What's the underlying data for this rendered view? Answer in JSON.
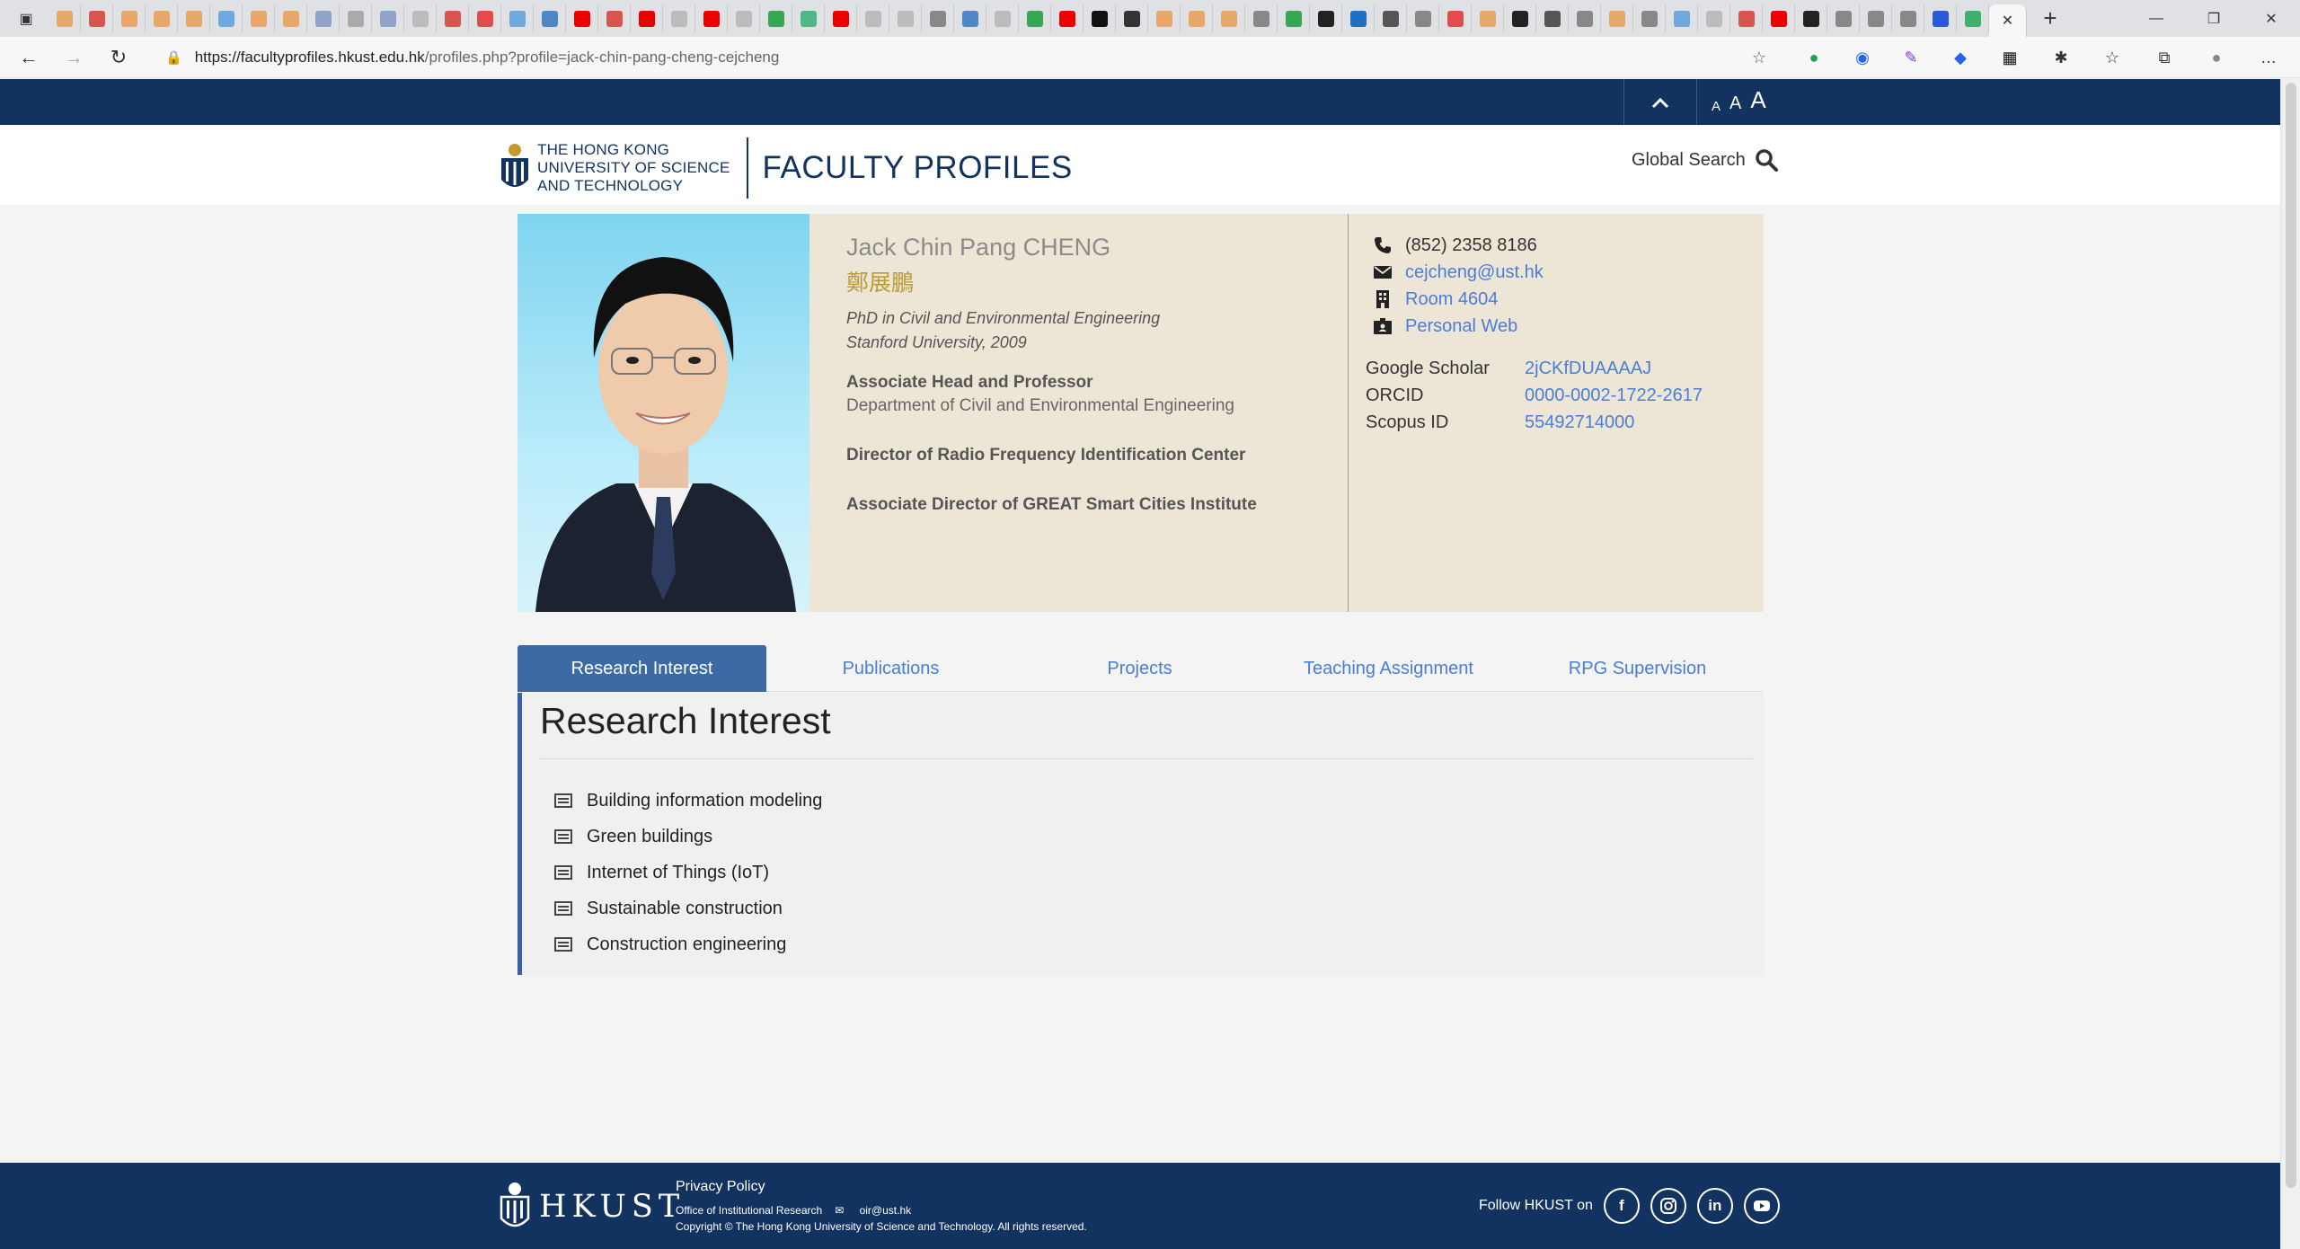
{
  "browser": {
    "url_domain": "https://facultyprofiles.hkust.edu.hk",
    "url_path": "/profiles.php?profile=jack-chin-pang-cheng-cejcheng",
    "tab_favicon_colors": [
      "#e8a86a",
      "#d9534f",
      "#e8a86a",
      "#e8a86a",
      "#e8a86a",
      "#6fa8dc",
      "#e8a86a",
      "#e8a86a",
      "#8fa4c8",
      "#aaa",
      "#8fa4c8",
      "#bbb",
      "#d9534f",
      "#e34c4c",
      "#6fa8dc",
      "#4f86c6",
      "#e00",
      "#d9534f",
      "#e00",
      "#bbb",
      "#e00",
      "#bbb",
      "#34a853",
      "#52b788",
      "#e00",
      "#bbb",
      "#bbb",
      "#888",
      "#4f86c6",
      "#bbb",
      "#34a853",
      "#e00",
      "#111",
      "#333",
      "#e8a86a",
      "#e8a86a",
      "#e8a86a",
      "#888",
      "#34a853",
      "#222",
      "#1f6fc7",
      "#555",
      "#888",
      "#e34c4c",
      "#e8a86a",
      "#222",
      "#555",
      "#888",
      "#e8a86a",
      "#888",
      "#6fa8dc",
      "#bbb",
      "#d9534f",
      "#e00",
      "#222",
      "#888",
      "#888",
      "#888",
      "#2a5bd7",
      "#41b06e"
    ]
  },
  "site": {
    "top_controls": {
      "font_small": "A",
      "font_medium": "A",
      "font_large": "A"
    },
    "university_name_lines": [
      "THE HONG KONG",
      "UNIVERSITY OF SCIENCE",
      "AND TECHNOLOGY"
    ],
    "section_title": "FACULTY PROFILES",
    "global_search_label": "Global Search"
  },
  "profile": {
    "name_en": "Jack Chin Pang CHENG",
    "name_zh": "鄭展鵬",
    "degree_line1": "PhD in Civil and Environmental Engineering",
    "degree_line2": "Stanford University, 2009",
    "roles": [
      {
        "title": "Associate Head and Professor",
        "dept": "Department of Civil and Environmental Engineering"
      },
      {
        "title": "Director of Radio Frequency Identification Center",
        "dept": ""
      },
      {
        "title": "Associate Director of GREAT Smart Cities Institute",
        "dept": ""
      }
    ],
    "contact": {
      "phone": "(852) 2358 8186",
      "email": "cejcheng@ust.hk",
      "room": "Room 4604",
      "web": "Personal Web"
    },
    "ids": [
      {
        "label": "Google Scholar",
        "value": "2jCKfDUAAAAJ"
      },
      {
        "label": "ORCID",
        "value": "0000-0002-1722-2617"
      },
      {
        "label": "Scopus ID",
        "value": "55492714000"
      }
    ]
  },
  "tabs": [
    "Research Interest",
    "Publications",
    "Projects",
    "Teaching Assignment",
    "RPG Supervision"
  ],
  "research": {
    "heading": "Research Interest",
    "items": [
      "Building information modeling",
      "Green buildings",
      "Internet of Things (IoT)",
      "Sustainable construction",
      "Construction engineering"
    ]
  },
  "footer": {
    "logo_word": "HKUST",
    "privacy": "Privacy Policy",
    "office": "Office of Institutional Research",
    "email": "oir@ust.hk",
    "copyright": "Copyright © The Hong Kong University of Science and Technology. All rights reserved.",
    "follow": "Follow HKUST on",
    "social": [
      "f",
      "ig",
      "in",
      "yt"
    ]
  }
}
